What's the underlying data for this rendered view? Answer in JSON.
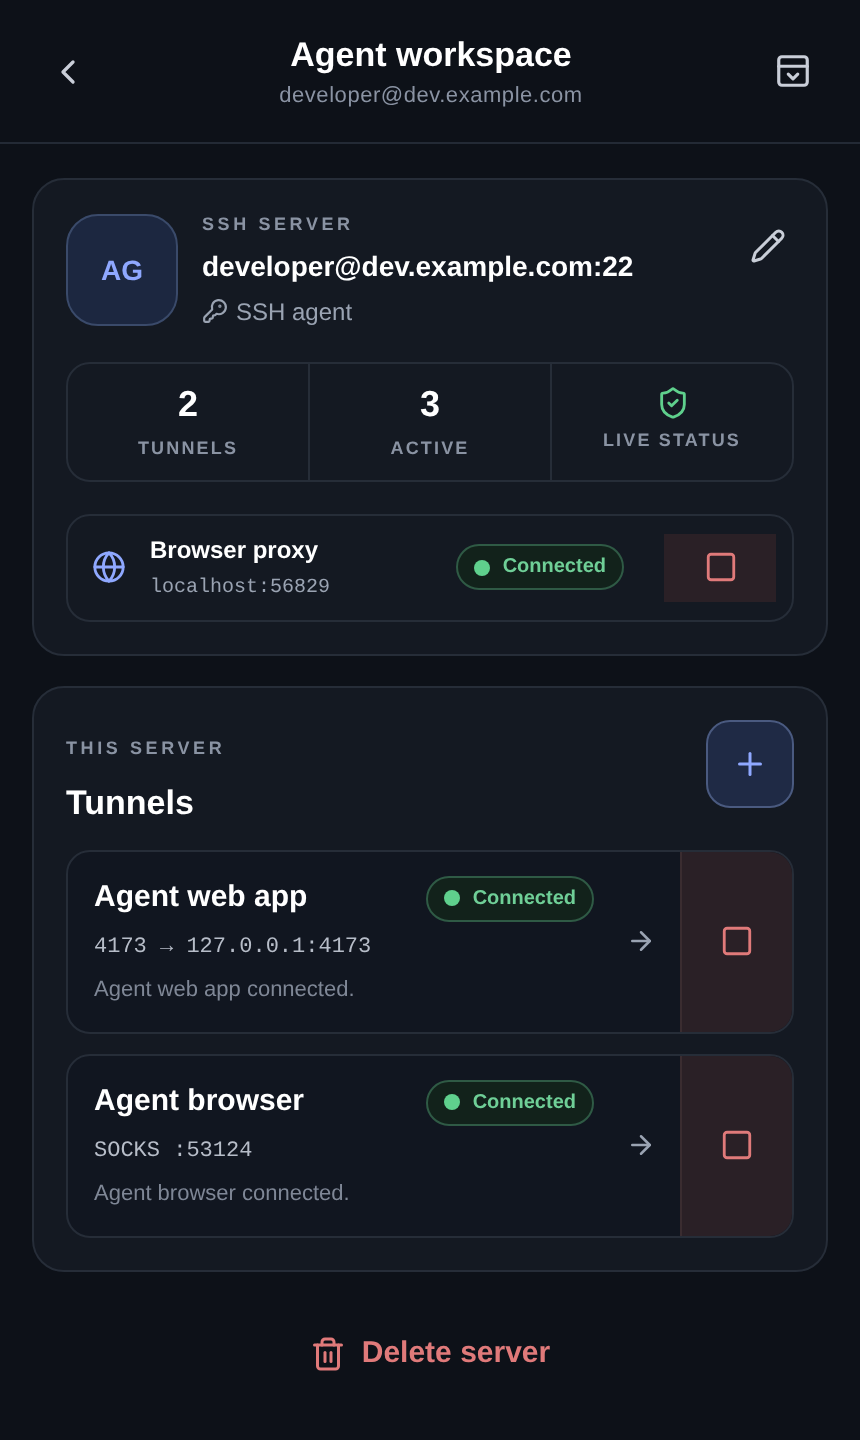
{
  "header": {
    "title": "Agent workspace",
    "subtitle": "developer@dev.example.com"
  },
  "server": {
    "avatar": "AG",
    "eyebrow": "SSH SERVER",
    "address": "developer@dev.example.com:22",
    "auth": "SSH agent",
    "stats": [
      {
        "kind": "number",
        "value": "2",
        "label": "TUNNELS"
      },
      {
        "kind": "number",
        "value": "3",
        "label": "ACTIVE"
      },
      {
        "kind": "icon",
        "label": "LIVE STATUS"
      }
    ],
    "proxy": {
      "name": "Browser proxy",
      "address": "localhost:56829",
      "status": "Connected"
    }
  },
  "tunnels": {
    "eyebrow": "THIS SERVER",
    "title": "Tunnels",
    "items": [
      {
        "name": "Agent web app",
        "route": "4173 → 127.0.0.1:4173",
        "message": "Agent web app connected.",
        "status": "Connected"
      },
      {
        "name": "Agent browser",
        "route": "SOCKS :53124",
        "message": "Agent browser connected.",
        "status": "Connected"
      }
    ]
  },
  "delete_label": "Delete server"
}
